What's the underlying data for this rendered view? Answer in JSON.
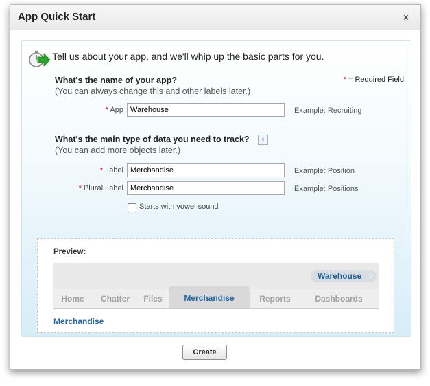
{
  "dialog": {
    "title": "App Quick Start",
    "close_glyph": "×"
  },
  "intro": {
    "text": "Tell us about your app, and we'll whip up the basic parts for you."
  },
  "app_section": {
    "title": "What's the name of your app?",
    "subtitle": "(You can always change this and other labels later.)",
    "required_legend_mark": "*",
    "required_legend_text": " = Required Field",
    "app_field": {
      "required_mark": "*",
      "label": "App",
      "value": "Warehouse",
      "example": "Example: Recruiting"
    }
  },
  "data_section": {
    "title": "What's the main type of data you need to track?",
    "info_glyph": "i",
    "subtitle": "(You can add more objects later.)",
    "label_field": {
      "required_mark": "*",
      "label": "Label",
      "value": "Merchandise",
      "example": "Example: Position"
    },
    "plural_field": {
      "required_mark": "*",
      "label": "Plural Label",
      "value": "Merchandise",
      "example": "Example: Positions"
    },
    "vowel_checkbox": {
      "label": "Starts with vowel sound",
      "checked": false
    }
  },
  "preview": {
    "label": "Preview:",
    "app_name": "Warehouse",
    "app_chevron": "v",
    "tabs": [
      {
        "label": "Home",
        "active": false
      },
      {
        "label": "Chatter",
        "active": false
      },
      {
        "label": "Files",
        "active": false
      },
      {
        "label": "Merchandise",
        "active": true
      },
      {
        "label": "Reports",
        "active": false
      },
      {
        "label": "Dashboards",
        "active": false
      }
    ],
    "link_text": "Merchandise"
  },
  "footer": {
    "create_label": "Create"
  },
  "colors": {
    "accent_link": "#2166a6",
    "required": "#cc0000",
    "arrow_green": "#2fa52f"
  }
}
